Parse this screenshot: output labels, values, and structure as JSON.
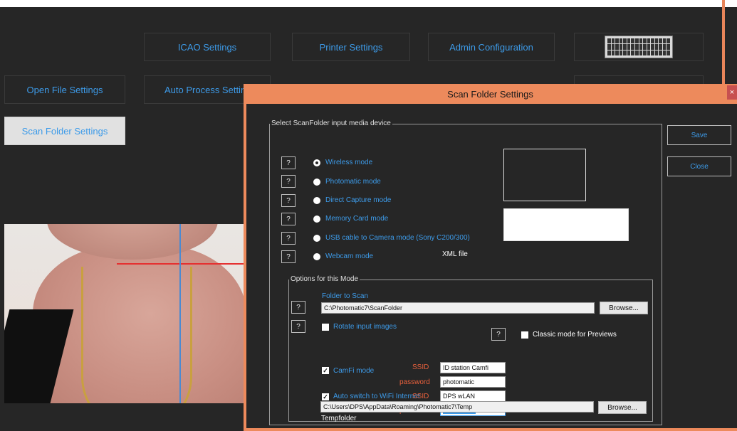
{
  "main": {
    "buttons_row1": [
      "ICAO Settings",
      "Printer Settings",
      "Admin Configuration"
    ],
    "keyboard_icon": "keyboard-icon",
    "buttons_row2": [
      "Open File Settings",
      "Auto Process Settings"
    ],
    "scan_folder_button": "Scan Folder Settings"
  },
  "dialog": {
    "title": "Scan Folder Settings",
    "close_glyph": "×",
    "device_group": {
      "legend": "Select ScanFolder input media device",
      "help": "?",
      "modes": [
        "Wireless mode",
        "Photomatic mode",
        "Direct Capture mode",
        "Memory Card mode",
        "USB cable to Camera mode (Sony C200/300)",
        "Webcam mode"
      ],
      "selected_mode": "Wireless mode",
      "xml_label": "XML file"
    },
    "options_group": {
      "legend": "Options for this Mode",
      "folder_label": "Folder to Scan",
      "folder_value": "C:\\Photomatic7\\ScanFolder",
      "browse": "Browse...",
      "rotate_label": "Rotate input images",
      "rotate_checked": false,
      "classic_label": "Classic mode for Previews",
      "classic_checked": false,
      "camfi_label": "CamFi mode",
      "camfi_checked": true,
      "ssid_label": "SSID",
      "password_label": "password",
      "camfi_ssid": "ID station Camfi",
      "camfi_password": "photomatic",
      "auto_switch_label": "Auto switch to WiFi Internet",
      "auto_switch_checked": true,
      "wifi_ssid": "DPS wLAN",
      "wifi_password": "••••••••••••••",
      "tempfolder_label": "Tempfolder",
      "tempfolder_value": "C:\\Users\\DPS\\AppData\\Roaming\\Photomatic7\\Temp",
      "browse2": "Browse..."
    },
    "save": "Save",
    "close": "Close"
  },
  "colors": {
    "accent": "#3d9be9",
    "dialog_border": "#ed8a5c",
    "background": "#262626",
    "warning_text": "#e8603c"
  }
}
